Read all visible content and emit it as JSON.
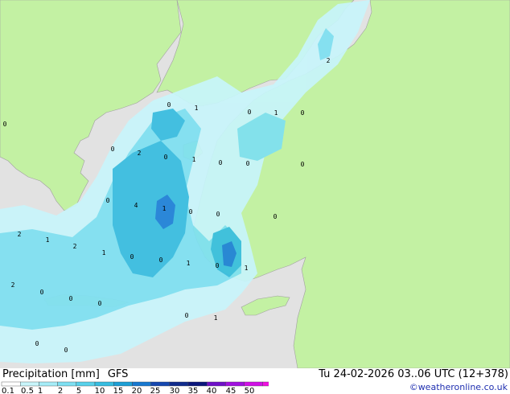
{
  "title": {
    "label": "Precipitation [mm]",
    "model": "GFS"
  },
  "valid_time": "Tu 24-02-2026 03..06 UTC (12+378)",
  "credit": "©weatheronline.co.uk",
  "legend": {
    "colors": [
      "#ffffff",
      "#c8f5fb",
      "#a5ecf7",
      "#7ee0f2",
      "#57d1ea",
      "#36bde0",
      "#1c9fd5",
      "#1778d0",
      "#1547b0",
      "#102b8c",
      "#0a167c",
      "#6e10c8",
      "#a010e0",
      "#d010e6",
      "#f010e0",
      "#e611b4"
    ],
    "ticks": [
      "0.1",
      "0.5",
      "1",
      "2",
      "5",
      "10",
      "15",
      "20",
      "25",
      "30",
      "35",
      "40",
      "45",
      "50"
    ]
  },
  "colors": {
    "land": "#c3f1a3",
    "sea": "#e2e2e2",
    "precip_light": "#c8f5fb",
    "precip_mid": "#7ee0f2",
    "precip_strong": "#36bde0",
    "precip_max": "#1c80d8"
  },
  "map_values": [
    "0",
    "1",
    "0",
    "1",
    "0",
    "2",
    "0",
    "0",
    "0",
    "1",
    "0",
    "0",
    "0",
    "2",
    "4",
    "0",
    "1",
    "0",
    "0",
    "0",
    "2",
    "1",
    "1",
    "2",
    "0",
    "1",
    "0",
    "0",
    "1",
    "2",
    "0",
    "0",
    "0",
    "0",
    "1",
    "0",
    "0"
  ]
}
